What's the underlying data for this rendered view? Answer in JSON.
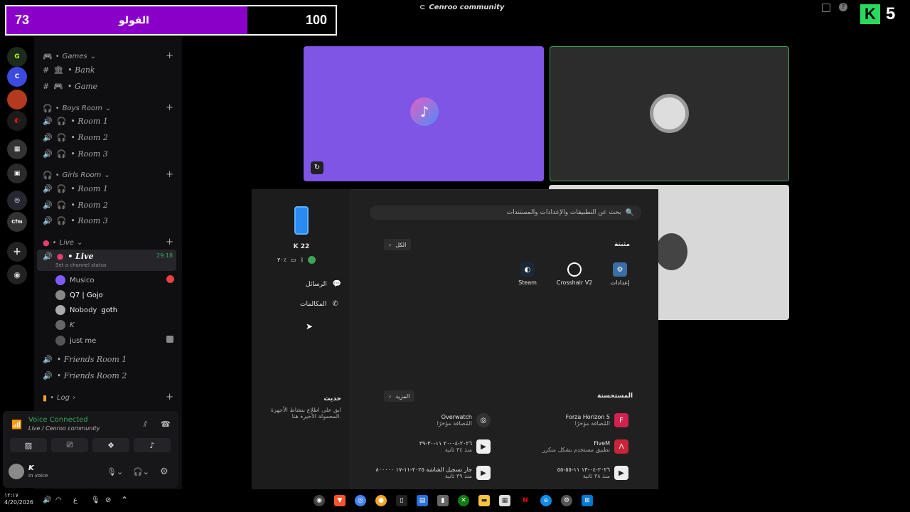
{
  "score": {
    "left_value": "73",
    "label": "الفولو",
    "right_value": "100"
  },
  "window": {
    "title": "Cenroo community",
    "badge": "5"
  },
  "categories": {
    "games": "Games",
    "boys": "Boys Room",
    "girls": "Girls Room",
    "live": "Live",
    "log": "Log"
  },
  "channels": {
    "bank": "• Bank",
    "game": "• Game",
    "boys_rooms": [
      "• Room 1",
      "• Room 2",
      "• Room 3"
    ],
    "girls_rooms": [
      "• Room 1",
      "• Room 2",
      "• Room 3"
    ],
    "live": "• Live",
    "live_timer": "29:18",
    "live_status": "Set a channel status",
    "friends1": "• Friends Room 1",
    "friends2": "• Friends Room 2"
  },
  "members": [
    "Musico",
    "Q7 | Gojo",
    "Nobody",
    "goth",
    "K",
    "just me"
  ],
  "voice": {
    "status": "Voice Connected",
    "channel": "Live / Cenroo community"
  },
  "user": {
    "name": "K",
    "status": "In voice"
  },
  "phone": {
    "name": "K 22",
    "battery": "٣٠٪",
    "messages": "الرسائل",
    "calls": "المكالمات",
    "recent_title": "حديث",
    "recent_desc": "ابق على اطلاع بنشاط الأجهزة المحمولة الأخيرة هنا."
  },
  "start": {
    "search_placeholder": "بحث عن التطبيقات والإعدادات والمستندات",
    "pinned_title": "مثبتة",
    "all_label": "الكل",
    "pinned_apps": [
      "إعدادات",
      "Crosshair V2",
      "Steam"
    ],
    "recommended_title": "المستحسنة",
    "more_label": "المزيد",
    "recommended": [
      {
        "name": "Forza Horizon 5",
        "desc": "المُضافة مؤخرًا"
      },
      {
        "name": "Overwatch",
        "desc": "المُضافة مؤخرًا"
      },
      {
        "name": "FiveM",
        "desc": "تطبيق مستخدم بشكل متكرر"
      },
      {
        "name": "٢٠٢٦-٠٤-٢٠ ١١-٣٠-٣٩",
        "desc": "منذ ٣٤ ثانية"
      },
      {
        "name": "٢٠٢٦-٠٤-١٣ ١١-٥٥-٥٥",
        "desc": "منذ ٣٨ ثانية"
      },
      {
        "name": "جار تسجيل الشاشة ٢٠٢٥-١١-١٧ ٨٠٠٠٠٠",
        "desc": "منذ ٣٩ ثانية"
      }
    ]
  },
  "taskbar": {
    "time": "١٢:١٧",
    "date": "4/20/2026",
    "lang": "ع"
  }
}
